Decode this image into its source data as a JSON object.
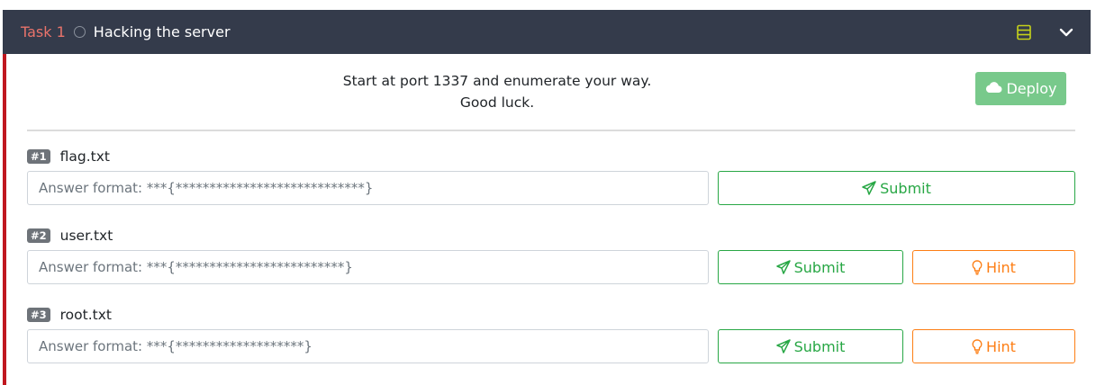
{
  "task": {
    "label": "Task 1",
    "title": "Hacking the server",
    "intro_line1": "Start at port 1337 and enumerate your way.",
    "intro_line2": "Good luck.",
    "deploy_label": "Deploy"
  },
  "questions": [
    {
      "badge": "#1",
      "title": "flag.txt",
      "placeholder": "Answer format: ***{****************************}",
      "submit_label": "Submit"
    },
    {
      "badge": "#2",
      "title": "user.txt",
      "placeholder": "Answer format: ***{*************************}",
      "submit_label": "Submit",
      "hint_label": "Hint"
    },
    {
      "badge": "#3",
      "title": "root.txt",
      "placeholder": "Answer format: ***{*******************}",
      "submit_label": "Submit",
      "hint_label": "Hint"
    }
  ],
  "colors": {
    "header_bg": "#343b4b",
    "task_label": "#e8736b",
    "accent_border": "#c0171f",
    "deploy_bg": "#78c98b",
    "submit": "#28a745",
    "hint": "#fd7e14",
    "server_icon": "#c6d21a"
  },
  "icons": {
    "status": "status-circle-icon",
    "server": "server-icon",
    "collapse": "chevron-down-icon",
    "deploy": "cloud-icon",
    "submit": "paper-plane-icon",
    "hint": "lightbulb-icon"
  }
}
